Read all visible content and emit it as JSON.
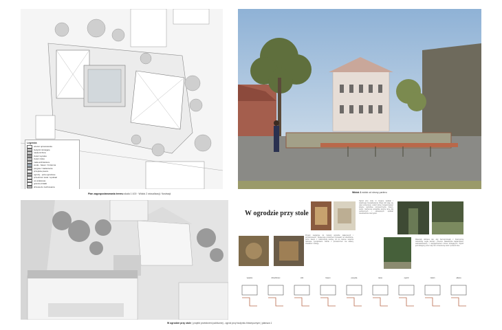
{
  "site_plan": {
    "caption_bold": "Plan zagospodarowania terenu",
    "caption_rest": " skala 1:100 · Widok 2 wizualizacji / ilustracji"
  },
  "legend": {
    "title": "Legenda",
    "items": [
      {
        "label": "obszar opracowania",
        "color": "#ffffff"
      },
      {
        "label": "budynki istniejące",
        "color": "#d8d8d8"
      },
      {
        "label": "nawierzchnia",
        "color": "#c9c9c9"
      },
      {
        "label": "zieleń wysoka",
        "color": "#a8a8a8"
      },
      {
        "label": "zieleń niska",
        "color": "#bdbdbd"
      },
      {
        "label": "mała architektura",
        "color": "#e0e0e0"
      },
      {
        "label": "woda - basen / fontanna",
        "color": "#9aa9b4"
      },
      {
        "label": "pergola / zadaszenie",
        "color": "#cfcfcf"
      },
      {
        "label": "przejścia piesze",
        "color": "#f0f0f0"
      },
      {
        "label": "ogrody - pola ogrodowe",
        "color": "#b3b3b3"
      },
      {
        "label": "przestrzeń stołu / spotkań",
        "color": "#e8e8e8"
      },
      {
        "label": "oś widokowa",
        "color": "#ffffff"
      },
      {
        "label": "granica działki",
        "color": "#ffffff"
      },
      {
        "label": "drzewa do zachowania",
        "color": "#c0c0c0"
      }
    ]
  },
  "render": {
    "caption_bold": "Widok 1",
    "caption_rest": " widok od strony parteru"
  },
  "board": {
    "title": "W ogrodzie przy stole",
    "text_col1": "Ogród przy stole to miejsce spotkań i wspólnego biesiadowania. Długi stół staje się osią kompozycji, wokół której zorganizowano kolejne ogrodowe pomieszczenia. Zieleń, woda i kamienna posadzka tworzą ramę dla codziennych i odświętnych spotkań mieszkańców oraz gości.",
    "text_col2": "Projekt nawiązuje do tradycji ogrodów pałacowych i przydomowych. Sekwencja przestrzeni prowadzi od dziedzińca, przez basen z roślinnością wodną, aż po zielone wnętrza osłonięte żywopłotami. Każde z pomieszczeń ma własny charakter i funkcję.",
    "text_col3": "Materiały dobrano tak, aby harmonizowały z historyczną zabudową: cegła, kamień i drewno. Nasadzenia zaplanowano wielowarstwowo, z uwzględnieniem drzew istniejących. Ogród jest dostępny przez cały rok i zmienia się wraz z porami roku.",
    "sequence": [
      {
        "label": "wejście"
      },
      {
        "label": "dziedziniec"
      },
      {
        "label": "stół"
      },
      {
        "label": "basen"
      },
      {
        "label": "pergola"
      },
      {
        "label": "taras"
      },
      {
        "label": "ogród"
      },
      {
        "label": "zieleń"
      },
      {
        "label": "altana"
      }
    ]
  },
  "footer": {
    "bold": "W ogrodzie przy stole",
    "rest": "  |  projekt przestrzeni publicznej - ogród przy budynku historycznym  |  plansza 1"
  }
}
